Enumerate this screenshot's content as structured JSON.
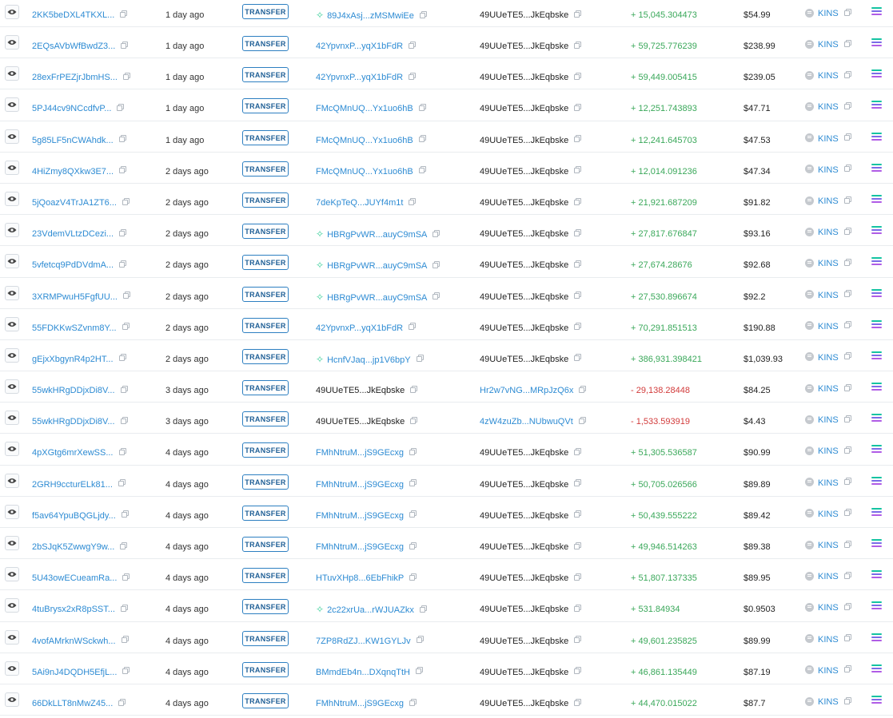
{
  "table": {
    "type_label": "TRANSFER",
    "token_label": "KINS",
    "rows": [
      {
        "signature": "2KK5beDXL4TKXL...",
        "time": "1 day ago",
        "from": "89J4xAsj...zMSMwiEe",
        "from_mark": true,
        "to": "49UUeTE5...JkEqbske",
        "amount": "+ 15,045.304473",
        "direction": "in",
        "usd": "$54.99"
      },
      {
        "signature": "2EQsAVbWfBwdZ3...",
        "time": "1 day ago",
        "from": "42YpvnxP...yqX1bFdR",
        "from_mark": false,
        "to": "49UUeTE5...JkEqbske",
        "amount": "+ 59,725.776239",
        "direction": "in",
        "usd": "$238.99"
      },
      {
        "signature": "28exFrPEZjrJbmHS...",
        "time": "1 day ago",
        "from": "42YpvnxP...yqX1bFdR",
        "from_mark": false,
        "to": "49UUeTE5...JkEqbske",
        "amount": "+ 59,449.005415",
        "direction": "in",
        "usd": "$239.05"
      },
      {
        "signature": "5PJ44cv9NCcdfvP...",
        "time": "1 day ago",
        "from": "FMcQMnUQ...Yx1uo6hB",
        "from_mark": false,
        "to": "49UUeTE5...JkEqbske",
        "amount": "+ 12,251.743893",
        "direction": "in",
        "usd": "$47.71"
      },
      {
        "signature": "5g85LF5nCWAhdk...",
        "time": "1 day ago",
        "from": "FMcQMnUQ...Yx1uo6hB",
        "from_mark": false,
        "to": "49UUeTE5...JkEqbske",
        "amount": "+ 12,241.645703",
        "direction": "in",
        "usd": "$47.53"
      },
      {
        "signature": "4HiZmy8QXkw3E7...",
        "time": "2 days ago",
        "from": "FMcQMnUQ...Yx1uo6hB",
        "from_mark": false,
        "to": "49UUeTE5...JkEqbske",
        "amount": "+ 12,014.091236",
        "direction": "in",
        "usd": "$47.34"
      },
      {
        "signature": "5jQoazV4TrJA1ZT6...",
        "time": "2 days ago",
        "from": "7deKpTeQ...JUYf4m1t",
        "from_mark": false,
        "to": "49UUeTE5...JkEqbske",
        "amount": "+ 21,921.687209",
        "direction": "in",
        "usd": "$91.82"
      },
      {
        "signature": "23VdemVLtzDCezi...",
        "time": "2 days ago",
        "from": "HBRgPvWR...auyC9mSA",
        "from_mark": true,
        "to": "49UUeTE5...JkEqbske",
        "amount": "+ 27,817.676847",
        "direction": "in",
        "usd": "$93.16"
      },
      {
        "signature": "5vfetcq9PdDVdmA...",
        "time": "2 days ago",
        "from": "HBRgPvWR...auyC9mSA",
        "from_mark": true,
        "to": "49UUeTE5...JkEqbske",
        "amount": "+ 27,674.28676",
        "direction": "in",
        "usd": "$92.68"
      },
      {
        "signature": "3XRMPwuH5FgfUU...",
        "time": "2 days ago",
        "from": "HBRgPvWR...auyC9mSA",
        "from_mark": true,
        "to": "49UUeTE5...JkEqbske",
        "amount": "+ 27,530.896674",
        "direction": "in",
        "usd": "$92.2"
      },
      {
        "signature": "55FDKKwSZvnm8Y...",
        "time": "2 days ago",
        "from": "42YpvnxP...yqX1bFdR",
        "from_mark": false,
        "to": "49UUeTE5...JkEqbske",
        "amount": "+ 70,291.851513",
        "direction": "in",
        "usd": "$190.88"
      },
      {
        "signature": "gEjxXbgynR4p2HT...",
        "time": "2 days ago",
        "from": "HcnfVJaq...jp1V6bpY",
        "from_mark": true,
        "to": "49UUeTE5...JkEqbske",
        "amount": "+ 386,931.398421",
        "direction": "in",
        "usd": "$1,039.93"
      },
      {
        "signature": "55wkHRgDDjxDi8V...",
        "time": "3 days ago",
        "from": "49UUeTE5...JkEqbske",
        "from_mark": false,
        "to": "Hr2w7vNG...MRpJzQ6x",
        "amount": "- 29,138.28448",
        "direction": "out",
        "usd": "$84.25"
      },
      {
        "signature": "55wkHRgDDjxDi8V...",
        "time": "3 days ago",
        "from": "49UUeTE5...JkEqbske",
        "from_mark": false,
        "to": "4zW4zuZb...NUbwuQVt",
        "amount": "- 1,533.593919",
        "direction": "out",
        "usd": "$4.43"
      },
      {
        "signature": "4pXGtg6mrXewSS...",
        "time": "4 days ago",
        "from": "FMhNtruM...jS9GEcxg",
        "from_mark": false,
        "to": "49UUeTE5...JkEqbske",
        "amount": "+ 51,305.536587",
        "direction": "in",
        "usd": "$90.99"
      },
      {
        "signature": "2GRH9ccturELk81...",
        "time": "4 days ago",
        "from": "FMhNtruM...jS9GEcxg",
        "from_mark": false,
        "to": "49UUeTE5...JkEqbske",
        "amount": "+ 50,705.026566",
        "direction": "in",
        "usd": "$89.89"
      },
      {
        "signature": "f5av64YpuBQGLjdy...",
        "time": "4 days ago",
        "from": "FMhNtruM...jS9GEcxg",
        "from_mark": false,
        "to": "49UUeTE5...JkEqbske",
        "amount": "+ 50,439.555222",
        "direction": "in",
        "usd": "$89.42"
      },
      {
        "signature": "2bSJqK5ZwwgY9w...",
        "time": "4 days ago",
        "from": "FMhNtruM...jS9GEcxg",
        "from_mark": false,
        "to": "49UUeTE5...JkEqbske",
        "amount": "+ 49,946.514263",
        "direction": "in",
        "usd": "$89.38"
      },
      {
        "signature": "5U43owECueamRa...",
        "time": "4 days ago",
        "from": "HTuvXHp8...6EbFhikP",
        "from_mark": false,
        "to": "49UUeTE5...JkEqbske",
        "amount": "+ 51,807.137335",
        "direction": "in",
        "usd": "$89.95"
      },
      {
        "signature": "4tuBrysx2xR8pSST...",
        "time": "4 days ago",
        "from": "2c22xrUa...rWJUAZkx",
        "from_mark": true,
        "to": "49UUeTE5...JkEqbske",
        "amount": "+ 531.84934",
        "direction": "in",
        "usd": "$0.9503"
      },
      {
        "signature": "4vofAMrknWSckwh...",
        "time": "4 days ago",
        "from": "7ZP8RdZJ...KW1GYLJv",
        "from_mark": false,
        "to": "49UUeTE5...JkEqbske",
        "amount": "+ 49,601.235825",
        "direction": "in",
        "usd": "$89.99"
      },
      {
        "signature": "5Ai9nJ4DQDH5EfjL...",
        "time": "4 days ago",
        "from": "BMmdEb4n...DXqnqTtH",
        "from_mark": false,
        "to": "49UUeTE5...JkEqbske",
        "amount": "+ 46,861.135449",
        "direction": "in",
        "usd": "$87.19"
      },
      {
        "signature": "66DkLLT8nMwZ45...",
        "time": "4 days ago",
        "from": "FMhNtruM...jS9GEcxg",
        "from_mark": false,
        "to": "49UUeTE5...JkEqbske",
        "amount": "+ 44,470.015022",
        "direction": "in",
        "usd": "$87.7"
      }
    ],
    "own_address": "49UUeTE5...JkEqbske",
    "colors": {
      "link": "#2d8bd3",
      "incoming": "#3aa85a",
      "outgoing": "#d23b3b",
      "badge_border": "#2d7fc1",
      "mark": "#3ccf9b"
    },
    "icons": {
      "view": "eye-icon",
      "copy": "copy-icon",
      "mark": "sparkle-icon",
      "token": "kin-token-icon",
      "details": "solana-lines-icon"
    }
  }
}
